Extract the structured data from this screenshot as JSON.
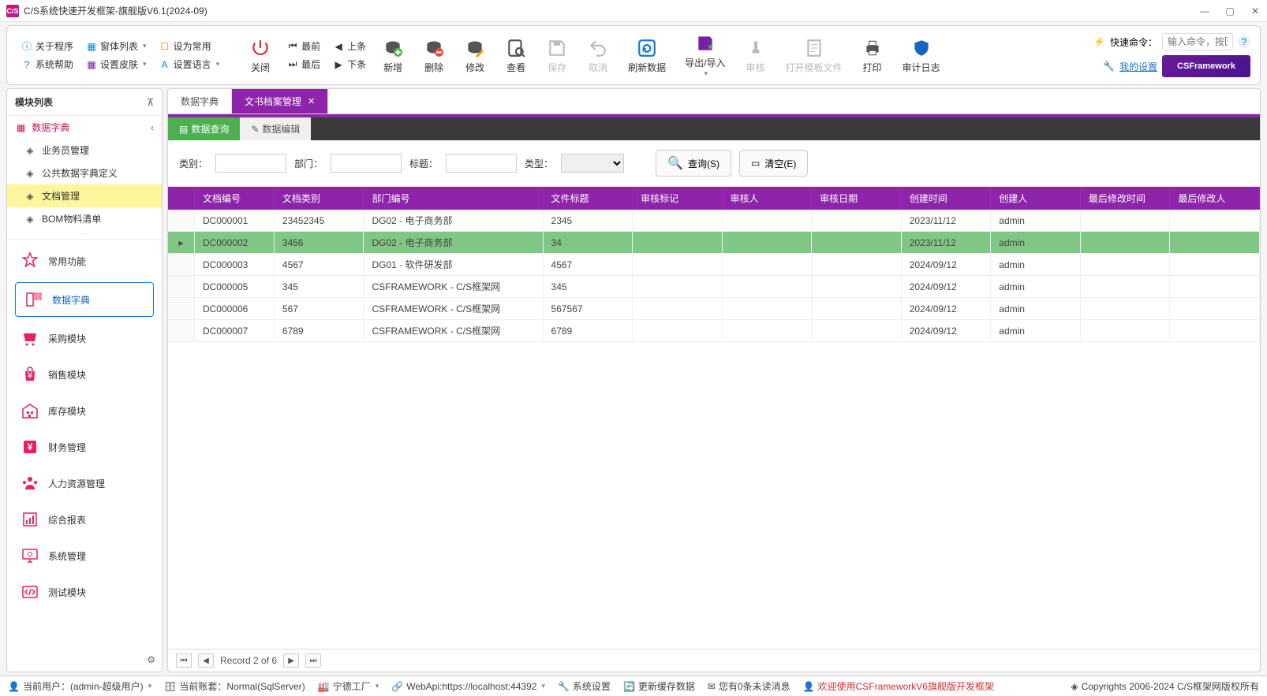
{
  "window": {
    "title": "C/S系统快速开发框架-旗舰版V6.1(2024-09)",
    "app_icon_text": "C/S"
  },
  "ribbon": {
    "about": "关于程序",
    "formlist": "窗体列表",
    "setcommon": "设为常用",
    "help": "系统帮助",
    "skin": "设置皮肤",
    "lang": "设置语言",
    "close": "关闭",
    "first": "最前",
    "prev": "上条",
    "last": "最后",
    "next": "下条",
    "add": "新增",
    "delete": "删除",
    "edit": "修改",
    "view": "查看",
    "save": "保存",
    "cancel": "取消",
    "refresh": "刷新数据",
    "export": "导出/导入",
    "audit": "审核",
    "opentpl": "打开模板文件",
    "print": "打印",
    "auditlog": "审计日志",
    "quick_label": "快速命令：",
    "quick_placeholder": "输入命令，按回车",
    "my_settings": "我的设置",
    "brand": "CSFramework"
  },
  "sidebar": {
    "title": "模块列表",
    "tree": {
      "root": "数据字典",
      "items": [
        "业务员管理",
        "公共数据字典定义",
        "文档管理",
        "BOM物料清单"
      ]
    },
    "nav": [
      "常用功能",
      "数据字典",
      "采购模块",
      "销售模块",
      "库存模块",
      "财务管理",
      "人力资源管理",
      "综合报表",
      "系统管理",
      "测试模块"
    ]
  },
  "tabs": {
    "t0": "数据字典",
    "t1": "文书档案管理"
  },
  "subtabs": {
    "s0": "数据查询",
    "s1": "数据编辑"
  },
  "filter": {
    "l_category": "类别：",
    "l_dept": "部门：",
    "l_title": "标题：",
    "l_type": "类型：",
    "btn_search": "查询(S)",
    "btn_clear": "清空(E)"
  },
  "grid": {
    "headers": [
      "文档编号",
      "文档类别",
      "部门编号",
      "文件标题",
      "审核标记",
      "审核人",
      "审核日期",
      "创建时间",
      "创建人",
      "最后修改时间",
      "最后修改人"
    ],
    "rows": [
      {
        "c": [
          "DC000001",
          "23452345",
          "DG02 - 电子商务部",
          "2345",
          "",
          "",
          "",
          "2023/11/12",
          "admin",
          "",
          ""
        ],
        "sel": false
      },
      {
        "c": [
          "DC000002",
          "3456",
          "DG02 - 电子商务部",
          "34",
          "",
          "",
          "",
          "2023/11/12",
          "admin",
          "",
          ""
        ],
        "sel": true
      },
      {
        "c": [
          "DC000003",
          "4567",
          "DG01 - 软件研发部",
          "4567",
          "",
          "",
          "",
          "2024/09/12",
          "admin",
          "",
          ""
        ],
        "sel": false
      },
      {
        "c": [
          "DC000005",
          "345",
          "CSFRAMEWORK - C/S框架网",
          "345",
          "",
          "",
          "",
          "2024/09/12",
          "admin",
          "",
          ""
        ],
        "sel": false
      },
      {
        "c": [
          "DC000006",
          "567",
          "CSFRAMEWORK - C/S框架网",
          "567567",
          "",
          "",
          "",
          "2024/09/12",
          "admin",
          "",
          ""
        ],
        "sel": false
      },
      {
        "c": [
          "DC000007",
          "6789",
          "CSFRAMEWORK - C/S框架网",
          "6789",
          "",
          "",
          "",
          "2024/09/12",
          "admin",
          "",
          ""
        ],
        "sel": false
      }
    ]
  },
  "pager": {
    "label": "Record 2 of 6"
  },
  "status": {
    "user": "当前用户：(admin-超级用户)",
    "account": "当前账套：Normal(SqlServer)",
    "factory": "宁德工厂",
    "webapi": "WebApi:https://localhost:44392",
    "settings": "系统设置",
    "updatecache": "更新缓存数据",
    "msgs": "您有0条未读消息",
    "welcome": "欢迎使用CSFrameworkV6旗舰版开发框架",
    "copyright": "Copyrights 2006-2024 C/S框架网版权所有"
  }
}
